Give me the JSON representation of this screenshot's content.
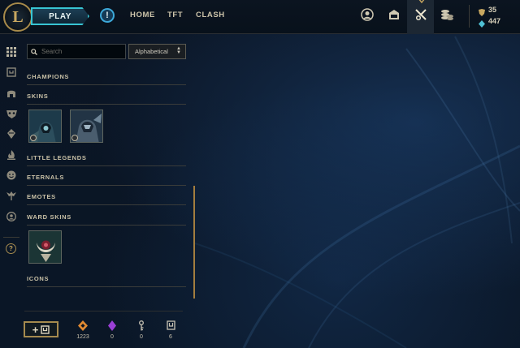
{
  "topbar": {
    "logo_letter": "L",
    "play_label": "PLAY",
    "alert_symbol": "!",
    "nav": [
      "HOME",
      "TFT",
      "CLASH"
    ],
    "icons": [
      "profile-icon",
      "collection-chest-icon",
      "loot-crafting-icon",
      "store-coins-icon"
    ],
    "currency": {
      "blue_essence": "35",
      "riot_points": "447"
    }
  },
  "rail": {
    "icons": [
      "grid-icon",
      "champion-token-icon",
      "helmet-icon",
      "mask-icon",
      "gem-icon",
      "flame-icon",
      "emote-face-icon",
      "ward-icon",
      "profile-circle-icon",
      "help-icon"
    ],
    "help_symbol": "?"
  },
  "filters": {
    "search_placeholder": "Search",
    "sort_value": "Alphabetical"
  },
  "sections": {
    "champions": "CHAMPIONS",
    "skins": "SKINS",
    "little_legends": "LITTLE LEGENDS",
    "eternals": "ETERNALS",
    "emotes": "EMOTES",
    "ward_skins": "WARD SKINS",
    "icons": "ICONS"
  },
  "footer": {
    "add_label": "+",
    "stats": [
      {
        "icon": "orange-essence-icon",
        "value": "1223",
        "color": "#e08a32"
      },
      {
        "icon": "purple-gem-icon",
        "value": "0",
        "color": "#9a3fd6"
      },
      {
        "icon": "key-icon",
        "value": "0",
        "color": "#c8c3b4"
      },
      {
        "icon": "chest-token-icon",
        "value": "6",
        "color": "#c8c3b4"
      }
    ]
  },
  "colors": {
    "accent_gold": "#a58a4e",
    "accent_cyan": "#38c5d3",
    "background": "#0a1320"
  }
}
